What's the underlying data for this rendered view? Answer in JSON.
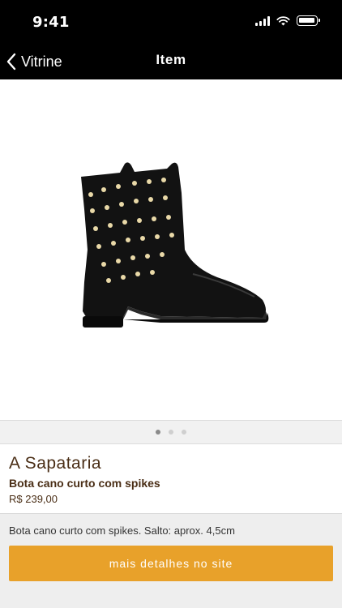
{
  "status_bar": {
    "time": "9:41"
  },
  "nav": {
    "back_label": "Vitrine",
    "title": "Item"
  },
  "gallery": {
    "page_count": 3,
    "active_page": 1
  },
  "product": {
    "store": "A Sapataria",
    "name": "Bota cano curto com spikes",
    "price": "R$ 239,00",
    "description": "Bota cano curto com spikes. Salto: aprox. 4,5cm",
    "cta_label": "mais detalhes no site"
  },
  "colors": {
    "nav_background": "#000000",
    "cta": "#e8a12a",
    "brand_text": "#4a2e16"
  }
}
